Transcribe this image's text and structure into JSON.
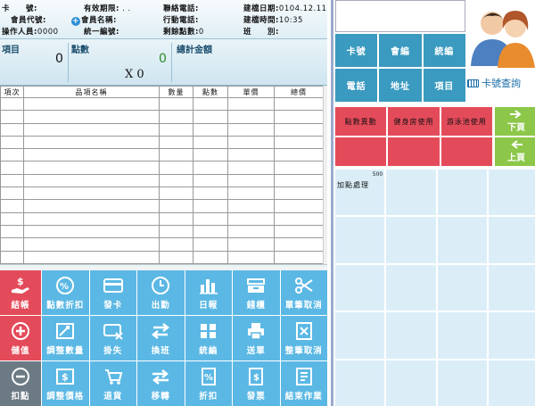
{
  "info": {
    "card_label": "卡　　號:",
    "expiry_label": "有效期限:",
    "expiry_value": ". .",
    "contact_label": "聯絡電話:",
    "created_date_label": "建檔日期:",
    "created_date_value": "0104.12.11",
    "member_code_label": "會員代號:",
    "member_name_label": "會員名稱:",
    "mobile_label": "行動電話:",
    "created_time_label": "建檔時間:",
    "created_time_value": "10:35",
    "operator_label": "操作人員:",
    "operator_value": "0000",
    "tax_id_label": "統一編號:",
    "remaining_points_label": "剩餘點數:",
    "remaining_points_value": "0",
    "class_label": "班　　別:"
  },
  "totals": {
    "items_label": "項目",
    "items_value": "0",
    "points_label": "點數",
    "points_value": "0",
    "multiplier": "X 0",
    "total_label": "總計金額"
  },
  "table": {
    "headers": [
      "項次",
      "品項名稱",
      "數量",
      "點數",
      "單價",
      "總價"
    ]
  },
  "function_buttons": [
    {
      "label": "結帳"
    },
    {
      "label": "點數折扣"
    },
    {
      "label": "發卡"
    },
    {
      "label": "出勤"
    },
    {
      "label": "日報"
    },
    {
      "label": "錢櫃"
    },
    {
      "label": "單筆取消"
    },
    {
      "label": "儲值"
    },
    {
      "label": "調整數量"
    },
    {
      "label": "掛失"
    },
    {
      "label": "換班"
    },
    {
      "label": "統編"
    },
    {
      "label": "送單"
    },
    {
      "label": "整筆取消"
    },
    {
      "label": "扣點"
    },
    {
      "label": "調整價格"
    },
    {
      "label": "退貨"
    },
    {
      "label": "移轉"
    },
    {
      "label": "折扣"
    },
    {
      "label": "發票"
    },
    {
      "label": "結束作業"
    }
  ],
  "right": {
    "filters": [
      "卡號",
      "會編",
      "統編",
      "電話",
      "地址",
      "項目"
    ],
    "query_label": "卡號查詢",
    "categories": [
      "點數異動",
      "健身房使用",
      "游泳池使用"
    ],
    "page_up": "下頁",
    "page_down": "上頁",
    "item": {
      "name": "加點處理",
      "points": "500"
    }
  },
  "colors": {
    "blue_button": "#5bb8e4",
    "red_button": "#e44b5a",
    "teal_button": "#3a9abf",
    "green_button": "#8cc74a",
    "item_cell": "#dbeef8"
  }
}
